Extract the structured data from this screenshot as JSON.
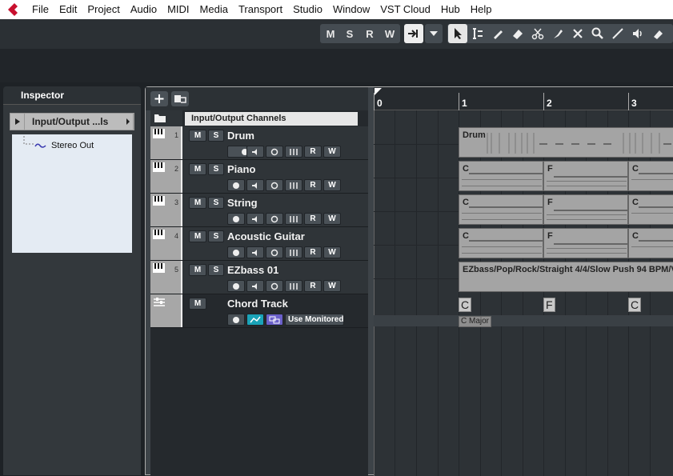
{
  "menu": [
    "File",
    "Edit",
    "Project",
    "Audio",
    "MIDI",
    "Media",
    "Transport",
    "Studio",
    "Window",
    "VST Cloud",
    "Hub",
    "Help"
  ],
  "toolbar": {
    "m": "M",
    "s": "S",
    "r": "R",
    "w": "W"
  },
  "inspector": {
    "tab": "Inspector",
    "selector": "Input/Output ...ls",
    "output": "Stereo Out"
  },
  "folder_header": "Input/Output Channels",
  "tracks": [
    {
      "num": "1",
      "name": "Drum"
    },
    {
      "num": "2",
      "name": "Piano"
    },
    {
      "num": "3",
      "name": "String"
    },
    {
      "num": "4",
      "name": "Acoustic Guitar"
    },
    {
      "num": "5",
      "name": "EZbass 01"
    }
  ],
  "chord_track": {
    "name": "Chord Track",
    "monitored": "Use Monitored"
  },
  "track_buttons": {
    "m": "M",
    "s": "S",
    "r": "R",
    "w": "W"
  },
  "ruler": [
    "0",
    "1",
    "2",
    "3"
  ],
  "parts": {
    "drum": "Drum",
    "ezbass": "EZbass/Pop/Rock/Straight 4/4/Slow Push 94 BPM/V",
    "chords": [
      "C",
      "F",
      "C"
    ]
  },
  "chord_events": [
    "C",
    "F",
    "C"
  ],
  "scale_event": "C Major"
}
